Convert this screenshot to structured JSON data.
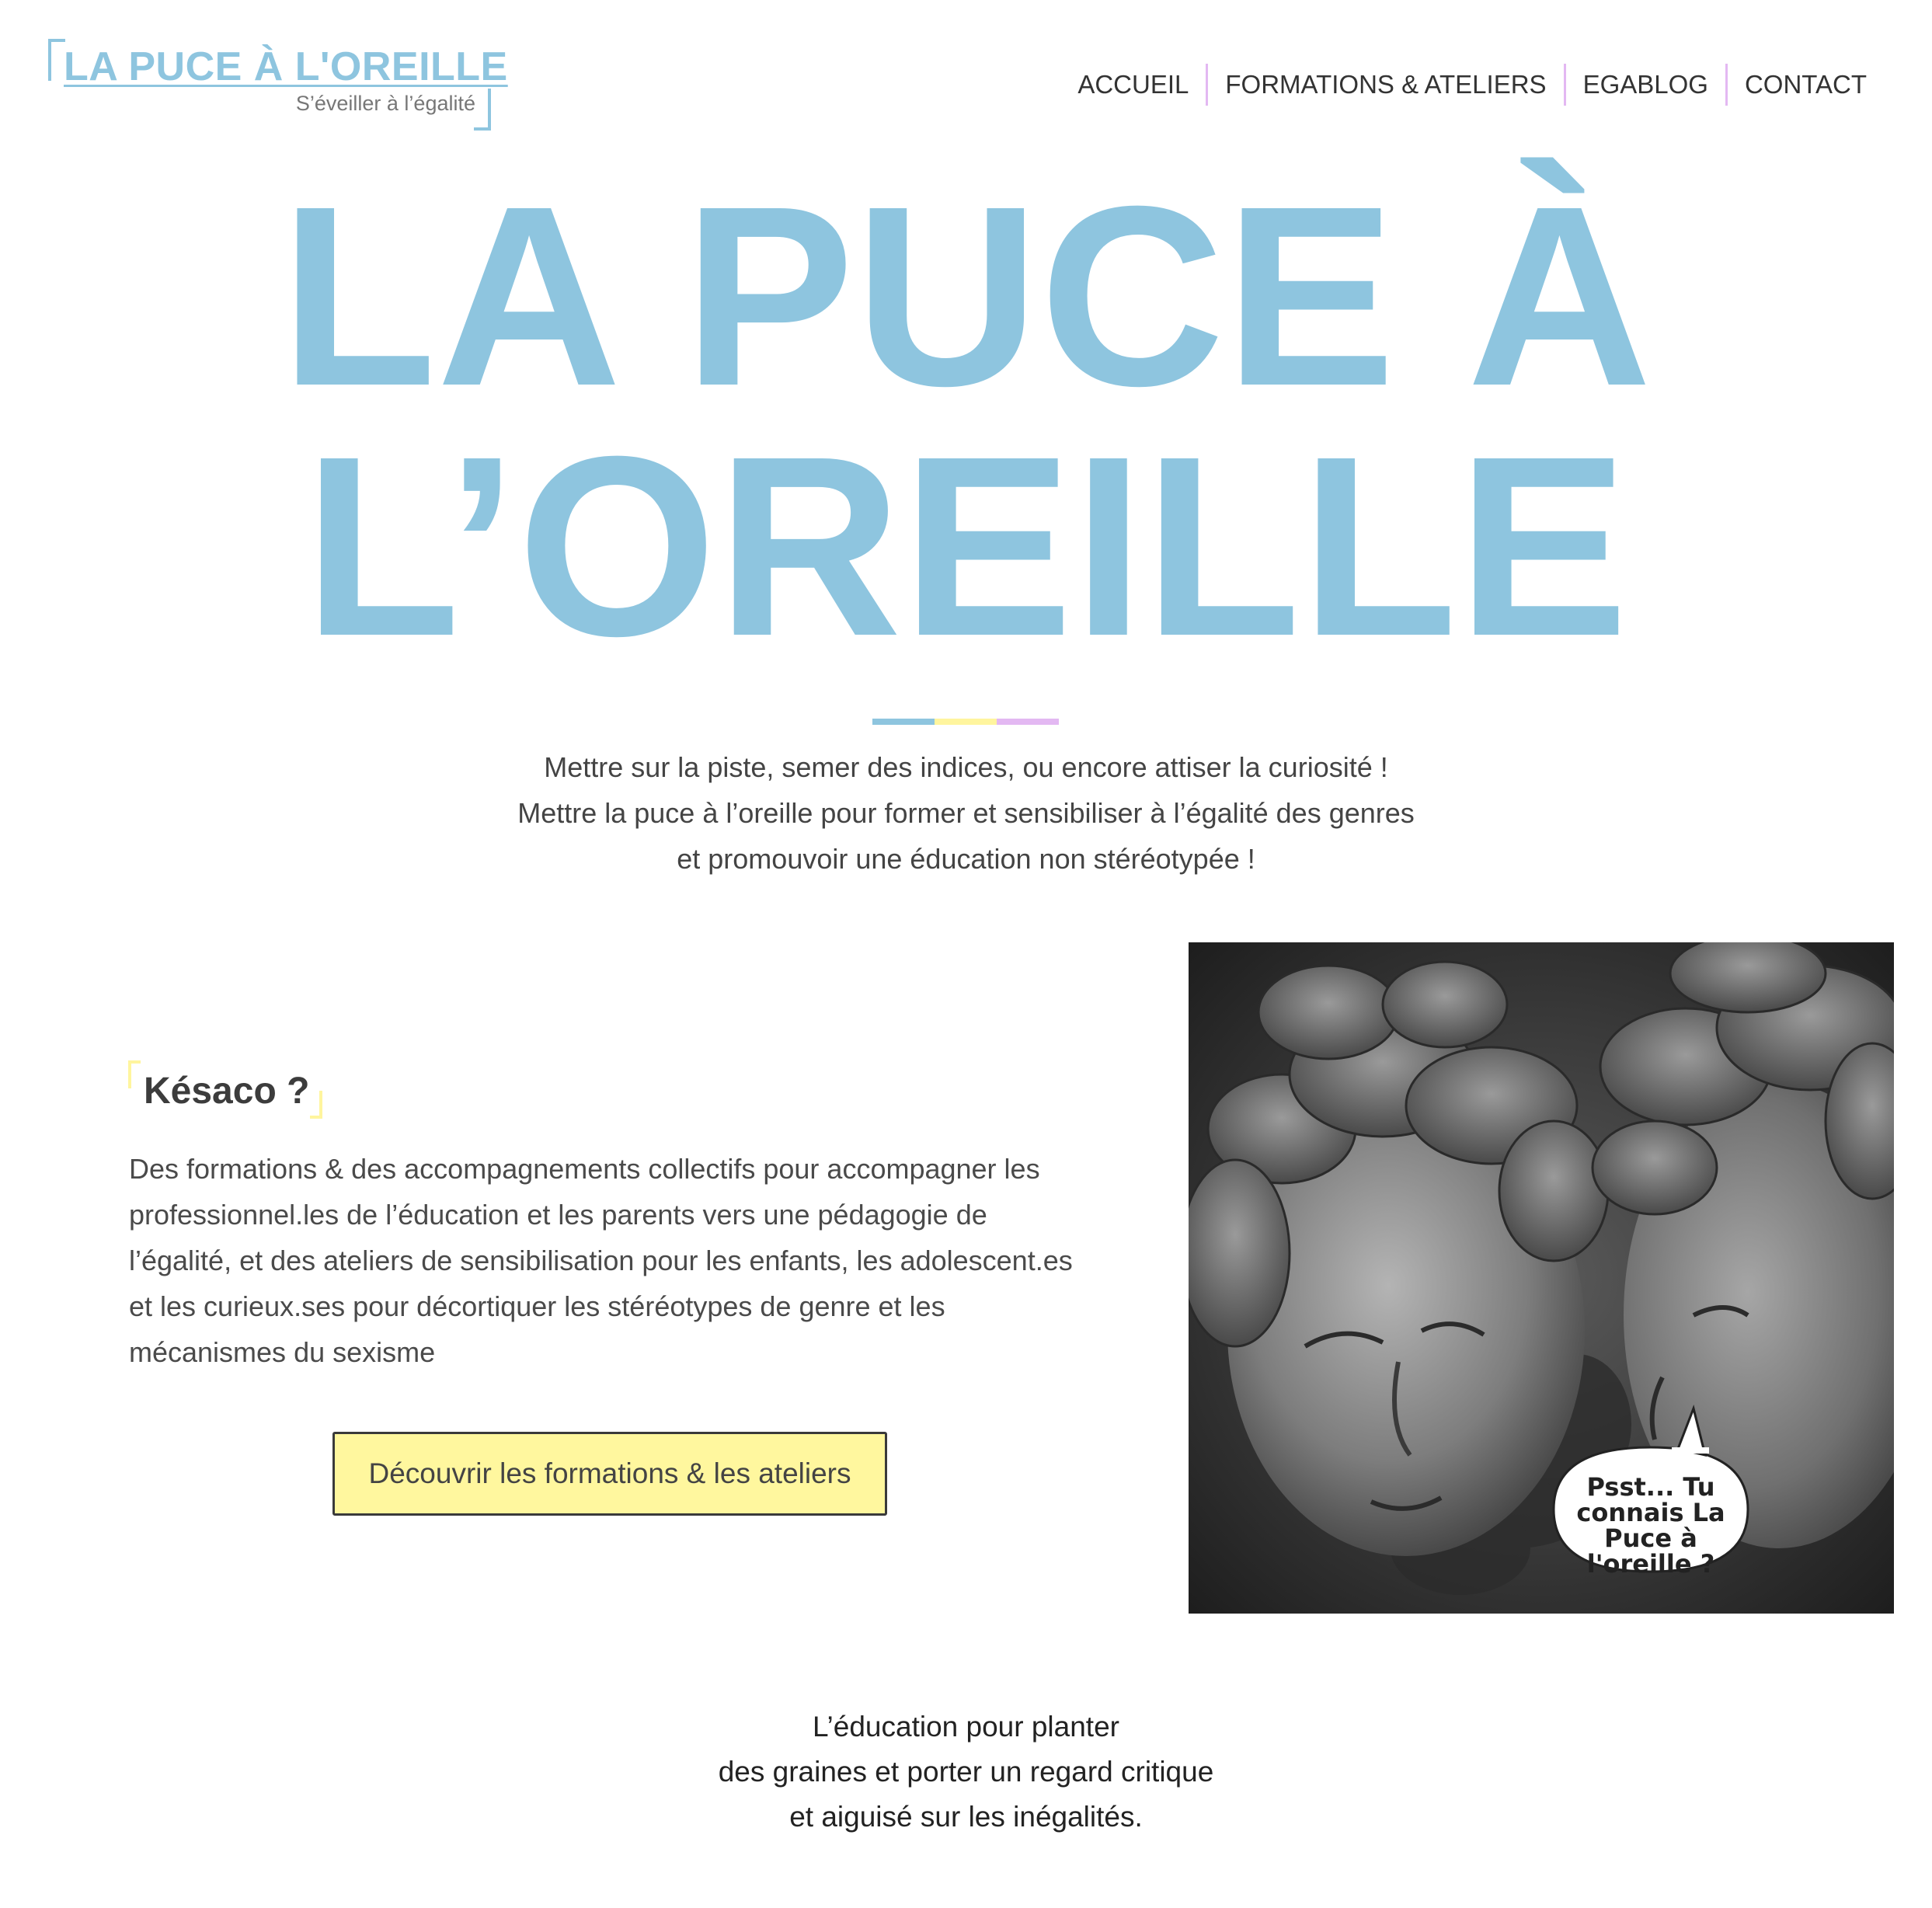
{
  "brand": {
    "title": "LA PUCE À L'OREILLE",
    "tagline": "S’éveiller à l’égalité"
  },
  "nav": {
    "items": [
      {
        "label": "ACCUEIL"
      },
      {
        "label": "FORMATIONS & ATELIERS"
      },
      {
        "label": "EGABLOG"
      },
      {
        "label": "CONTACT"
      }
    ]
  },
  "hero": {
    "line1": "LA PUCE À",
    "line2": "L’OREILLE",
    "intro": [
      "Mettre sur la piste, semer des indices, ou encore attiser la curiosité !",
      "Mettre la puce à l’oreille pour former et sensibiliser à l’égalité des genres",
      "et promouvoir une éducation non stéréotypée !"
    ]
  },
  "kesaco": {
    "title": "Késaco ?",
    "text_lines": [
      "Des formations & des accompagnements collectifs pour accompagner les",
      "professionnel.les de l’éducation et les parents vers une pédagogie de",
      "l’égalité, et des ateliers de sensibilisation pour les enfants, les adolescent.es",
      "et les curieux.ses pour décortiquer les stéréotypes de genre et les",
      "mécanismes du sexisme"
    ],
    "button_label": "Découvrir les formations & les ateliers"
  },
  "photo": {
    "speech_lines": [
      "Psst... Tu",
      "connais La",
      "Puce à",
      "l'oreille ?"
    ]
  },
  "closing": {
    "lines": [
      "L’éducation pour planter",
      "des graines et porter un regard critique",
      "et aiguisé sur les inégalités."
    ]
  },
  "colors": {
    "accent_blue": "#8ec5df",
    "accent_yellow": "#fff59e",
    "accent_purple": "#e3b8f2",
    "text": "#444444"
  }
}
